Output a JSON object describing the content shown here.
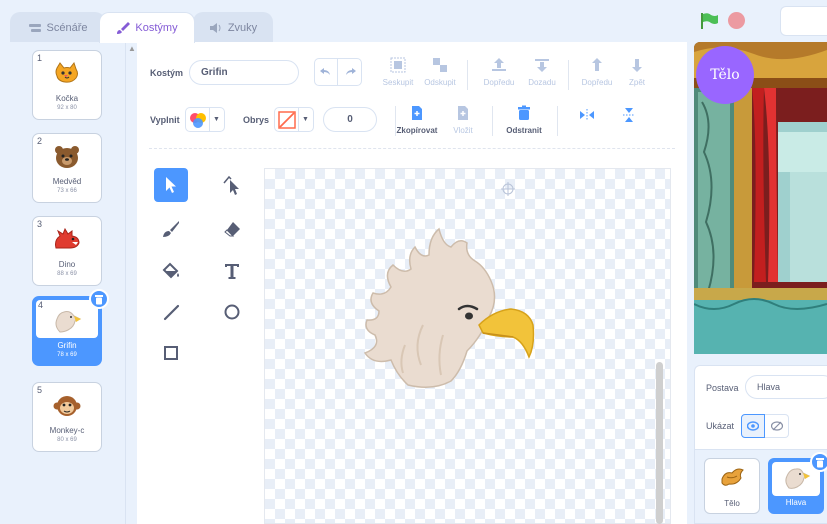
{
  "tabs": [
    {
      "label": "Scénáře",
      "active": false
    },
    {
      "label": "Kostýmy",
      "active": true
    },
    {
      "label": "Zvuky",
      "active": false
    }
  ],
  "costumes": [
    {
      "number": "1",
      "name": "Kočka",
      "size": "92 x 80",
      "icon": "cat-icon"
    },
    {
      "number": "2",
      "name": "Medvěd",
      "size": "73 x 66",
      "icon": "bear-icon"
    },
    {
      "number": "3",
      "name": "Dino",
      "size": "88 x 69",
      "icon": "dino-icon"
    },
    {
      "number": "4",
      "name": "Grifin",
      "size": "78 x 69",
      "icon": "griffin-icon",
      "selected": true
    },
    {
      "number": "5",
      "name": "Monkey-c",
      "size": "80 x 69",
      "icon": "monkey-icon"
    }
  ],
  "toolbar": {
    "costume_label": "Kostým",
    "costume_name": "Grifin",
    "fill_label": "Vyplnit",
    "outline_label": "Obrys",
    "outline_width": "0",
    "group": "Seskupit",
    "ungroup": "Odskupit",
    "forward": "Dopředu",
    "backward": "Dozadu",
    "front": "Dopředu",
    "back": "Zpět",
    "copy": "Zkopírovat",
    "paste": "Vložit",
    "delete": "Odstranit"
  },
  "stage": {
    "title": "Tělo"
  },
  "sprite_info": {
    "sprite_label": "Postava",
    "sprite_name": "Hlava",
    "show_label": "Ukázat"
  },
  "sprites": [
    {
      "name": "Tělo",
      "icon": "body-icon"
    },
    {
      "name": "Hlava",
      "icon": "head-icon",
      "selected": true
    }
  ],
  "colors": {
    "accent": "#855cd6",
    "selection": "#4c97ff",
    "stage_title_bg": "#9966ff"
  }
}
